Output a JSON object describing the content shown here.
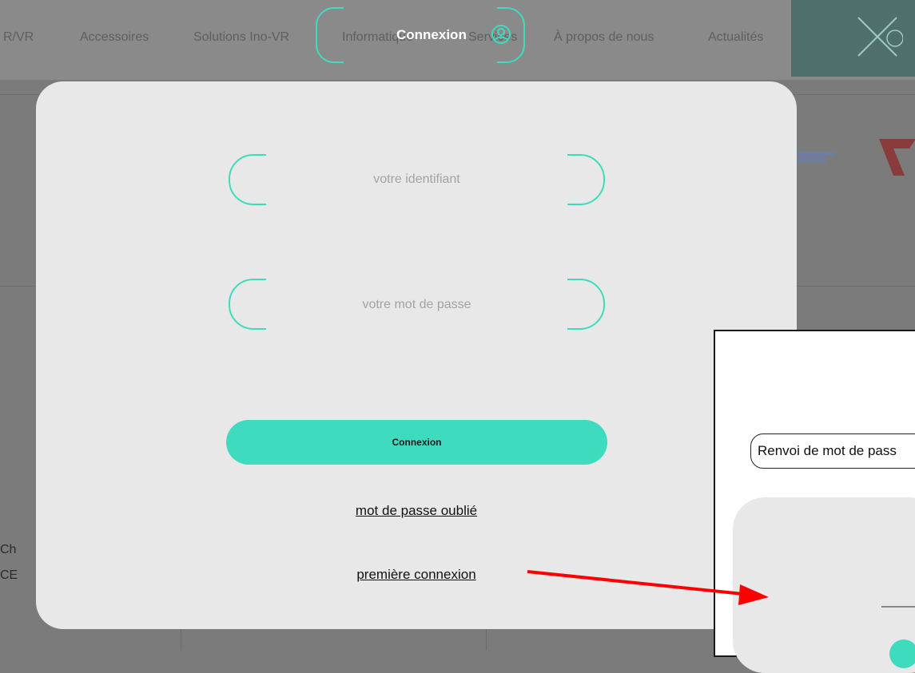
{
  "nav": {
    "items": [
      "R/VR",
      "Accessoires",
      "Solutions Ino-VR",
      "Informatique",
      "Services",
      "À propos de nous",
      "Actualités"
    ],
    "tab_title": "Connexion"
  },
  "background": {
    "side_text_1": "Ch",
    "side_text_2": "CE"
  },
  "login": {
    "username_placeholder": "votre identifiant",
    "password_placeholder": "votre mot de passe",
    "submit_label": "Connexion",
    "forgot_password": "mot de passe oublié",
    "first_login": "première connexion"
  },
  "inset": {
    "pill_label": "Renvoi de mot de pass"
  },
  "colors": {
    "accent": "#3fdbbf",
    "arrow": "#ff0000",
    "modal_bg": "#e8e8e8",
    "overlay_bg": "#7b7b7b"
  }
}
